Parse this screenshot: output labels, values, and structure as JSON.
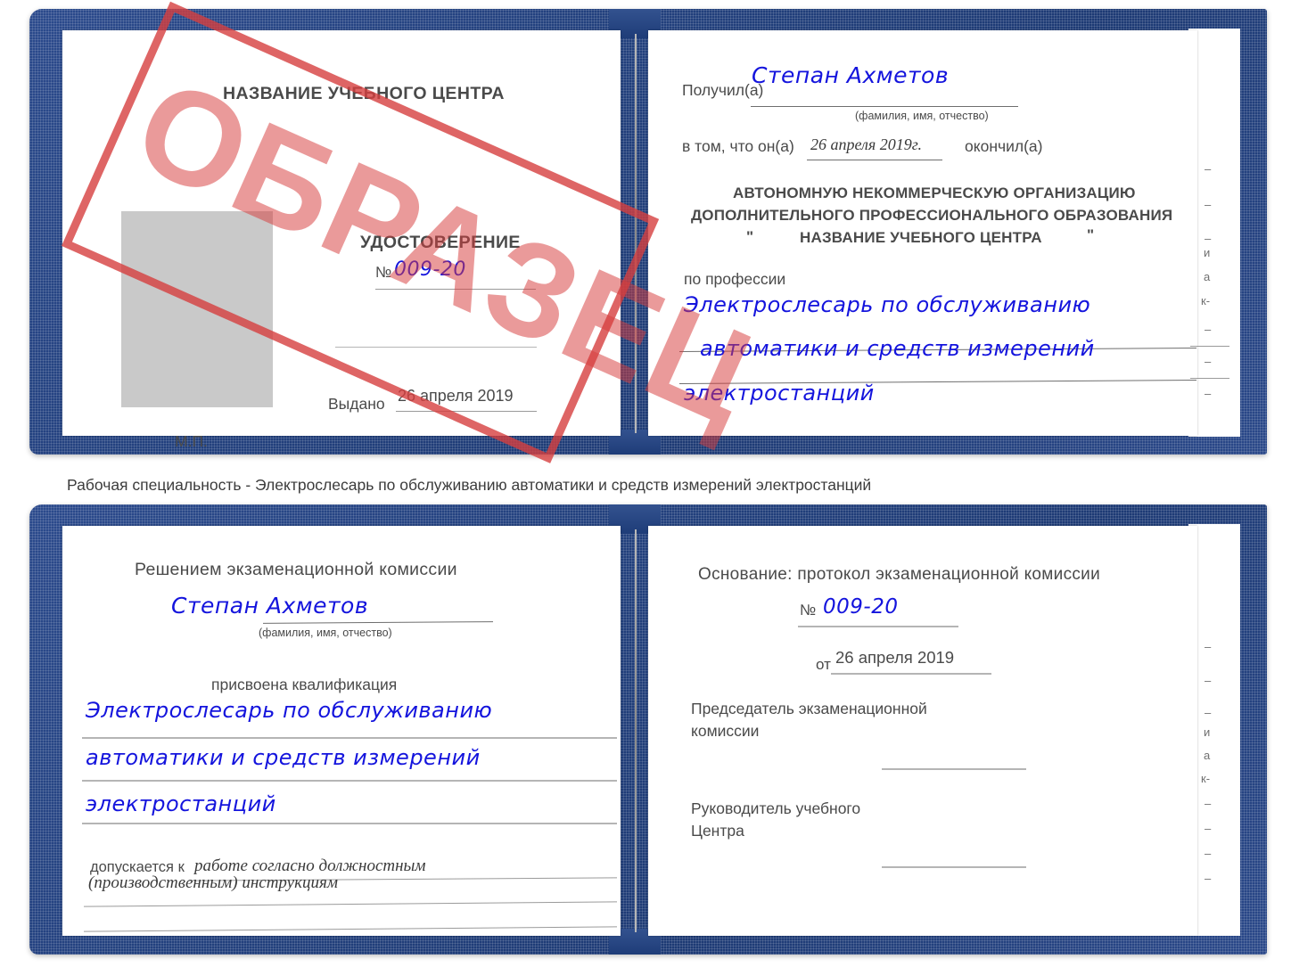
{
  "document": {
    "kind": "certificate-scan",
    "stamp": {
      "text": "ОБРАЗЕЦ",
      "color": "#d63e3e"
    },
    "caption": "Рабочая специальность - Электрослесарь по обслуживанию автоматики и средств измерений электростанций"
  },
  "cert_top": {
    "left_page": {
      "org_title": "НАЗВАНИЕ УЧЕБНОГО ЦЕНТРА",
      "doc_type": "УДОСТОВЕРЕНИЕ",
      "number_label": "№",
      "number_value": "009-20",
      "issued_label": "Выдано",
      "issued_value": "26 апреля 2019",
      "seal_label": "М.П."
    },
    "right_page": {
      "received_label": "Получил(а)",
      "received_value": "Степан Ахметов",
      "name_hint": "(фамилия, имя, отчество)",
      "in_that_label": "в том, что он(а)",
      "in_that_value": "26 апреля 2019г.",
      "finished_label": "окончил(а)",
      "org_line1": "АВТОНОМНУЮ НЕКОММЕРЧЕСКУЮ ОРГАНИЗАЦИЮ",
      "org_line2": "ДОПОЛНИТЕЛЬНОГО ПРОФЕССИОНАЛЬНОГО ОБРАЗОВАНИЯ",
      "org_quote_open": "\"",
      "org_line3": "НАЗВАНИЕ УЧЕБНОГО ЦЕНТРА",
      "org_quote_close": "\"",
      "profession_label": "по профессии",
      "profession_line1": "Электрослесарь по обслуживанию",
      "profession_line2": "автоматики и средств измерений",
      "profession_line3": "электростанций"
    },
    "trim_marks": [
      "–",
      "–",
      "–",
      "и",
      "а",
      "к-"
    ]
  },
  "cert_bottom": {
    "left_page": {
      "decision_title": "Решением экзаменационной комиссии",
      "name_value": "Степан Ахметов",
      "name_hint": "(фамилия, имя, отчество)",
      "qualification_label": "присвоена квалификация",
      "qualification_line1": "Электрослесарь по обслуживанию",
      "qualification_line2": "автоматики и средств измерений",
      "qualification_line3": "электростанций",
      "admitted_label": "допускается к",
      "admitted_line1": "работе согласно должностным",
      "admitted_line2": "(производственным) инструкциям"
    },
    "right_page": {
      "basis_label": "Основание: протокол экзаменационной комиссии",
      "number_label": "№",
      "number_value": "009-20",
      "date_label": "от",
      "date_value": "26 апреля 2019",
      "chairman_line1": "Председатель экзаменационной",
      "chairman_line2": "комиссии",
      "head_line1": "Руководитель учебного",
      "head_line2": "Центра"
    },
    "trim_marks": [
      "–",
      "–",
      "–",
      "и",
      "а",
      "к-",
      "–",
      "–",
      "–",
      "–"
    ]
  }
}
